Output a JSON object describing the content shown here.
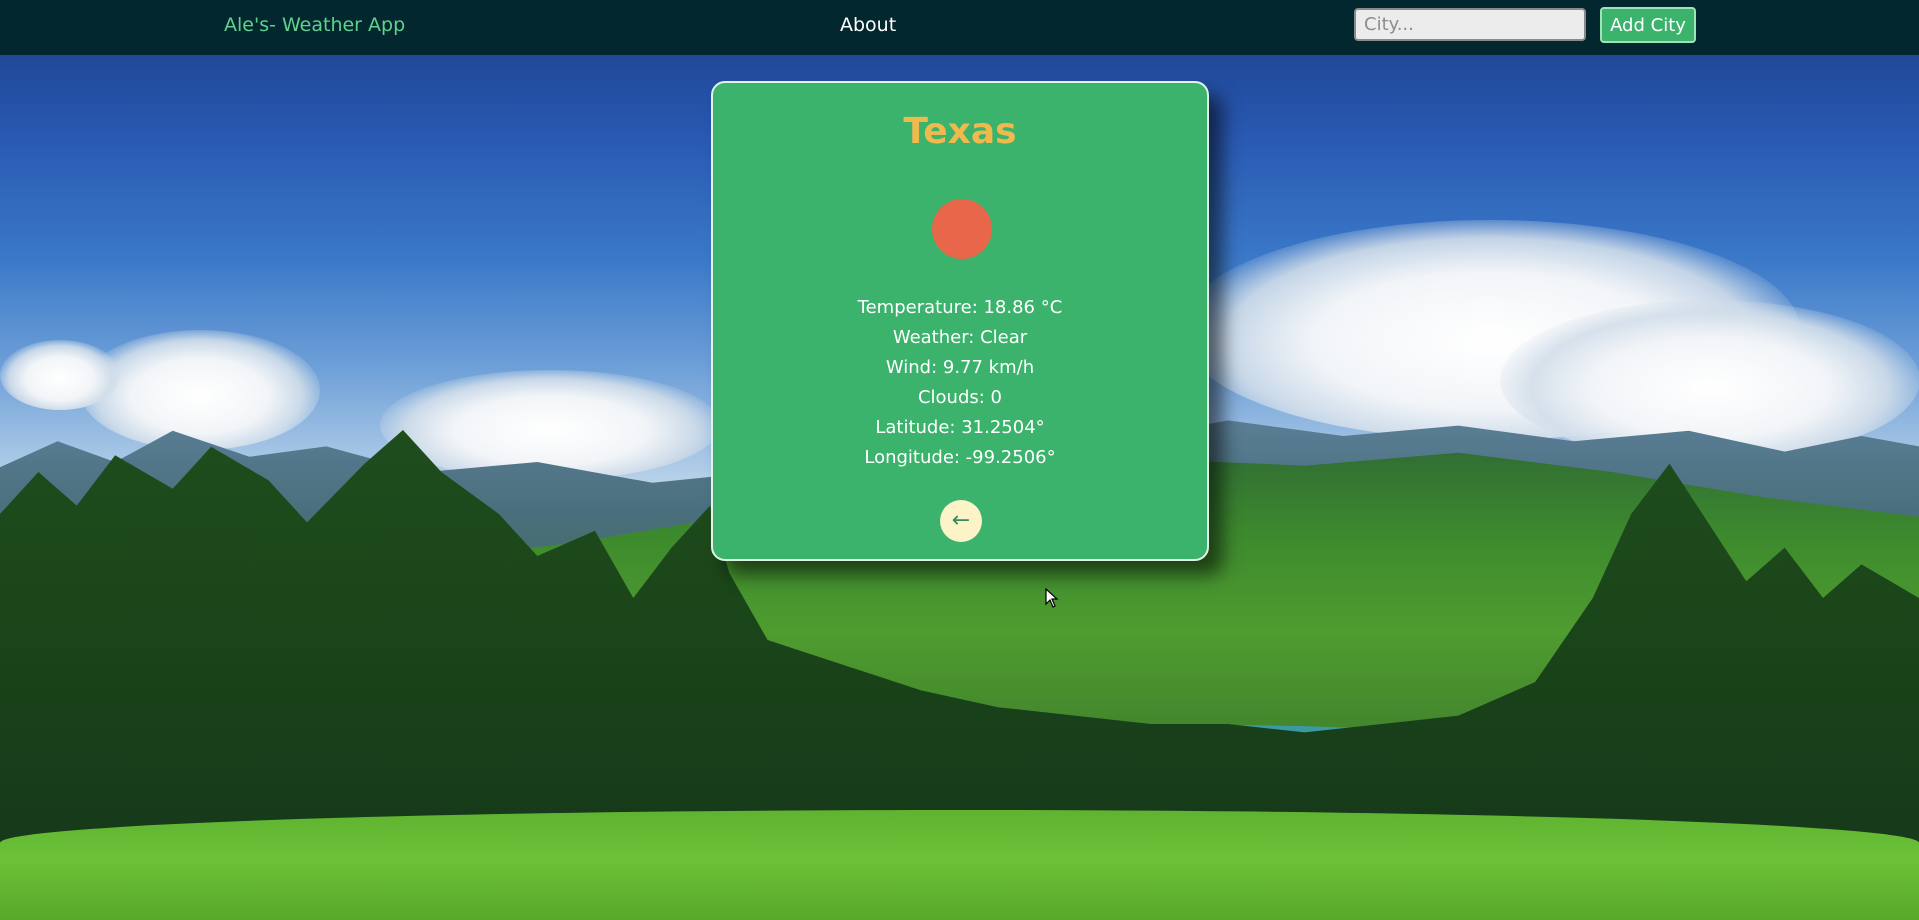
{
  "navbar": {
    "brand": "Ale's- Weather App",
    "about": "About",
    "city_placeholder": "City...",
    "add_city_label": "Add City"
  },
  "card": {
    "city": "Texas",
    "weather_icon": "sun-icon",
    "temperature": "Temperature: 18.86 °C",
    "weather": "Weather: Clear",
    "wind": "Wind: 9.77 km/h",
    "clouds": "Clouds: 0",
    "latitude": "Latitude: 31.2504°",
    "longitude": "Longitude: -99.2506°",
    "back_icon": "arrow-left-icon"
  },
  "colors": {
    "navbar_bg": "#03272e",
    "brand": "#5ed38e",
    "card_bg": "#3bb36c",
    "title": "#efb94e",
    "sun": "#e8674a",
    "back_button_bg": "#fcf3c8"
  }
}
